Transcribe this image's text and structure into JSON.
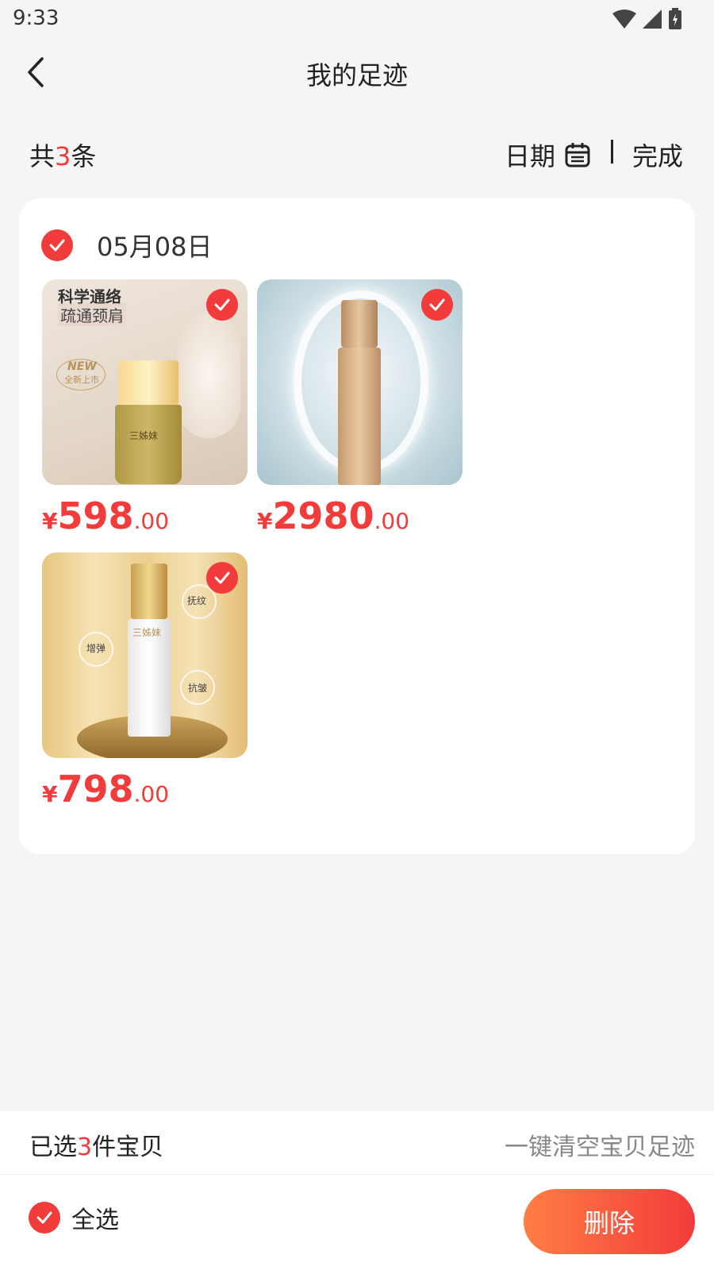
{
  "status": {
    "time": "9:33"
  },
  "nav": {
    "title": "我的足迹",
    "back_icon": "chevron-left-icon"
  },
  "summary": {
    "count_prefix": "共",
    "count": "3",
    "count_suffix": "条",
    "date_label": "日期",
    "done_label": "完成"
  },
  "group": {
    "date": "05月08日",
    "products": [
      {
        "currency": "¥",
        "price_int": "598",
        "price_dec": ".00",
        "texts": [
          "科学通络",
          "疏通颈肩",
          "NEW",
          "全新上市",
          "三姊妹"
        ],
        "selected": true
      },
      {
        "currency": "¥",
        "price_int": "2980",
        "price_dec": ".00",
        "texts": [],
        "selected": true
      },
      {
        "currency": "¥",
        "price_int": "798",
        "price_dec": ".00",
        "texts": [
          "抚纹",
          "增弹",
          "抗皱",
          "三姊妹"
        ],
        "selected": true
      }
    ]
  },
  "bottom": {
    "selected_prefix": "已选",
    "selected_count": "3",
    "selected_suffix": "件宝贝",
    "clear_label": "一键清空宝贝足迹",
    "select_all_label": "全选",
    "delete_label": "删除"
  },
  "colors": {
    "accent": "#f23b3b",
    "background": "#f5f5f5"
  }
}
